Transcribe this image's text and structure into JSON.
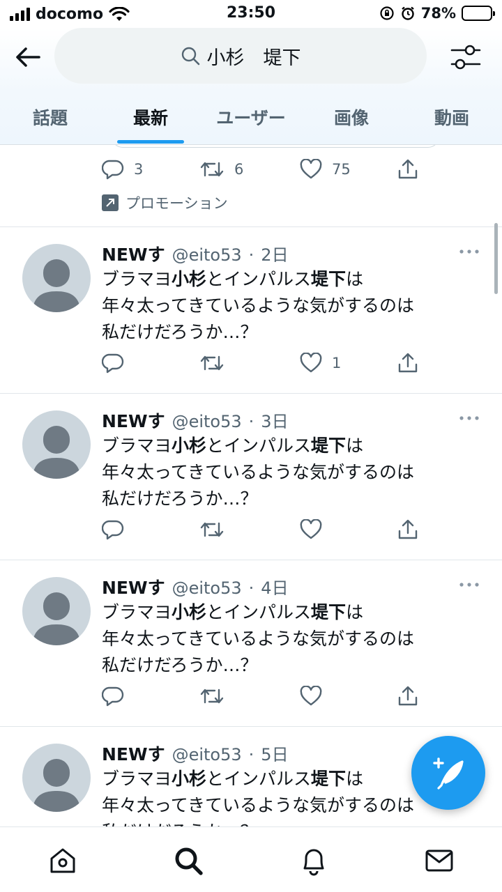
{
  "status_bar": {
    "carrier": "docomo",
    "time": "23:50",
    "battery_pct": "78%",
    "battery_level": 0.78
  },
  "search": {
    "query": "小杉　堤下"
  },
  "tabs": [
    {
      "label": "話題",
      "active": false
    },
    {
      "label": "最新",
      "active": true
    },
    {
      "label": "ユーザー",
      "active": false
    },
    {
      "label": "画像",
      "active": false
    },
    {
      "label": "動画",
      "active": false
    }
  ],
  "promoted_tweet": {
    "replies": "3",
    "retweets": "6",
    "likes": "75",
    "promo_label": "プロモーション"
  },
  "tweets": [
    {
      "name": "NEWす",
      "handle": "@eito53",
      "time": "2日",
      "line1_a": "ブラマヨ",
      "line1_b": "小杉",
      "line1_c": "とインパルス",
      "line1_d": "堤下",
      "line1_e": "は",
      "line2": "年々太ってきているような気がするのは",
      "line3": "私だけだろうか…？",
      "likes": "1"
    },
    {
      "name": "NEWす",
      "handle": "@eito53",
      "time": "3日",
      "line1_a": "ブラマヨ",
      "line1_b": "小杉",
      "line1_c": "とインパルス",
      "line1_d": "堤下",
      "line1_e": "は",
      "line2": "年々太ってきているような気がするのは",
      "line3": "私だけだろうか…？",
      "likes": ""
    },
    {
      "name": "NEWす",
      "handle": "@eito53",
      "time": "4日",
      "line1_a": "ブラマヨ",
      "line1_b": "小杉",
      "line1_c": "とインパルス",
      "line1_d": "堤下",
      "line1_e": "は",
      "line2": "年々太ってきているような気がするのは",
      "line3": "私だけだろうか…？",
      "likes": ""
    },
    {
      "name": "NEWす",
      "handle": "@eito53",
      "time": "5日",
      "line1_a": "ブラマヨ",
      "line1_b": "小杉",
      "line1_c": "とインパルス",
      "line1_d": "堤下",
      "line1_e": "は",
      "line2": "年々太ってきているような気がするのは",
      "line3": "私だけだろうか…？",
      "likes": ""
    }
  ],
  "bottom_nav": [
    {
      "icon": "home-icon"
    },
    {
      "icon": "search-icon",
      "active": true
    },
    {
      "icon": "bell-icon"
    },
    {
      "icon": "mail-icon"
    }
  ],
  "colors": {
    "accent": "#1d9bf0",
    "muted": "#536471",
    "text": "#0f1419"
  }
}
